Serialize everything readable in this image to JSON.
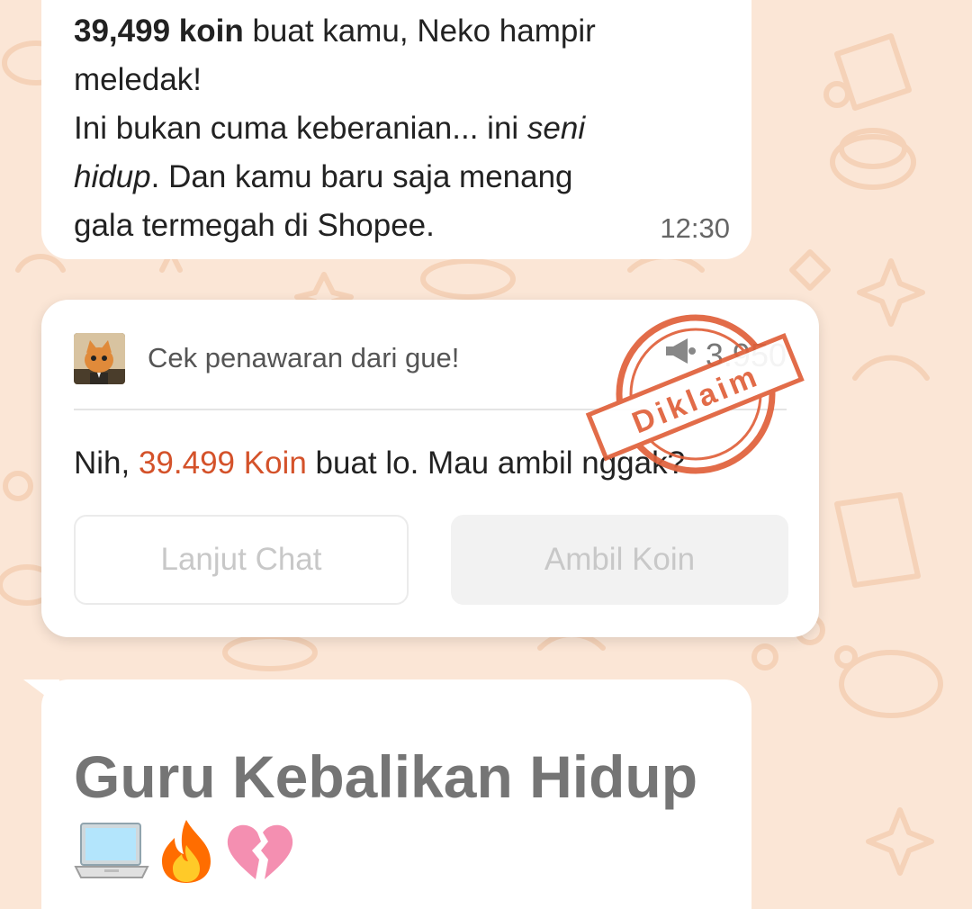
{
  "message_top": {
    "bold_text": "39,499 koin",
    "line1_rest": " buat kamu, Neko hampir",
    "line2": "meledak!",
    "line3_start": "Ini bukan cuma keberanian... ini ",
    "line3_italic": "seni",
    "line4_italic": "hidup",
    "line4_rest": ". Dan kamu baru saja menang",
    "line5": "gala termegah di Shopee.",
    "time": "12:30"
  },
  "offer_card": {
    "title": "Cek penawaran dari gue!",
    "coin_count": "3.950",
    "body_prefix": "Nih, ",
    "amount": "39.499 Koin",
    "body_suffix": " buat lo. Mau ambil nggak?",
    "secondary_button": "Lanjut Chat",
    "primary_button": "Ambil Koin",
    "stamp_label": "Diklaim"
  },
  "message_bottom": {
    "headline": "Guru Kebalikan Hidup",
    "emojis": [
      "laptop-icon",
      "fire-icon",
      "broken-heart-icon"
    ]
  },
  "colors": {
    "background": "#fbe6d6",
    "accent": "#d4522a",
    "stamp": "#e0603a"
  }
}
